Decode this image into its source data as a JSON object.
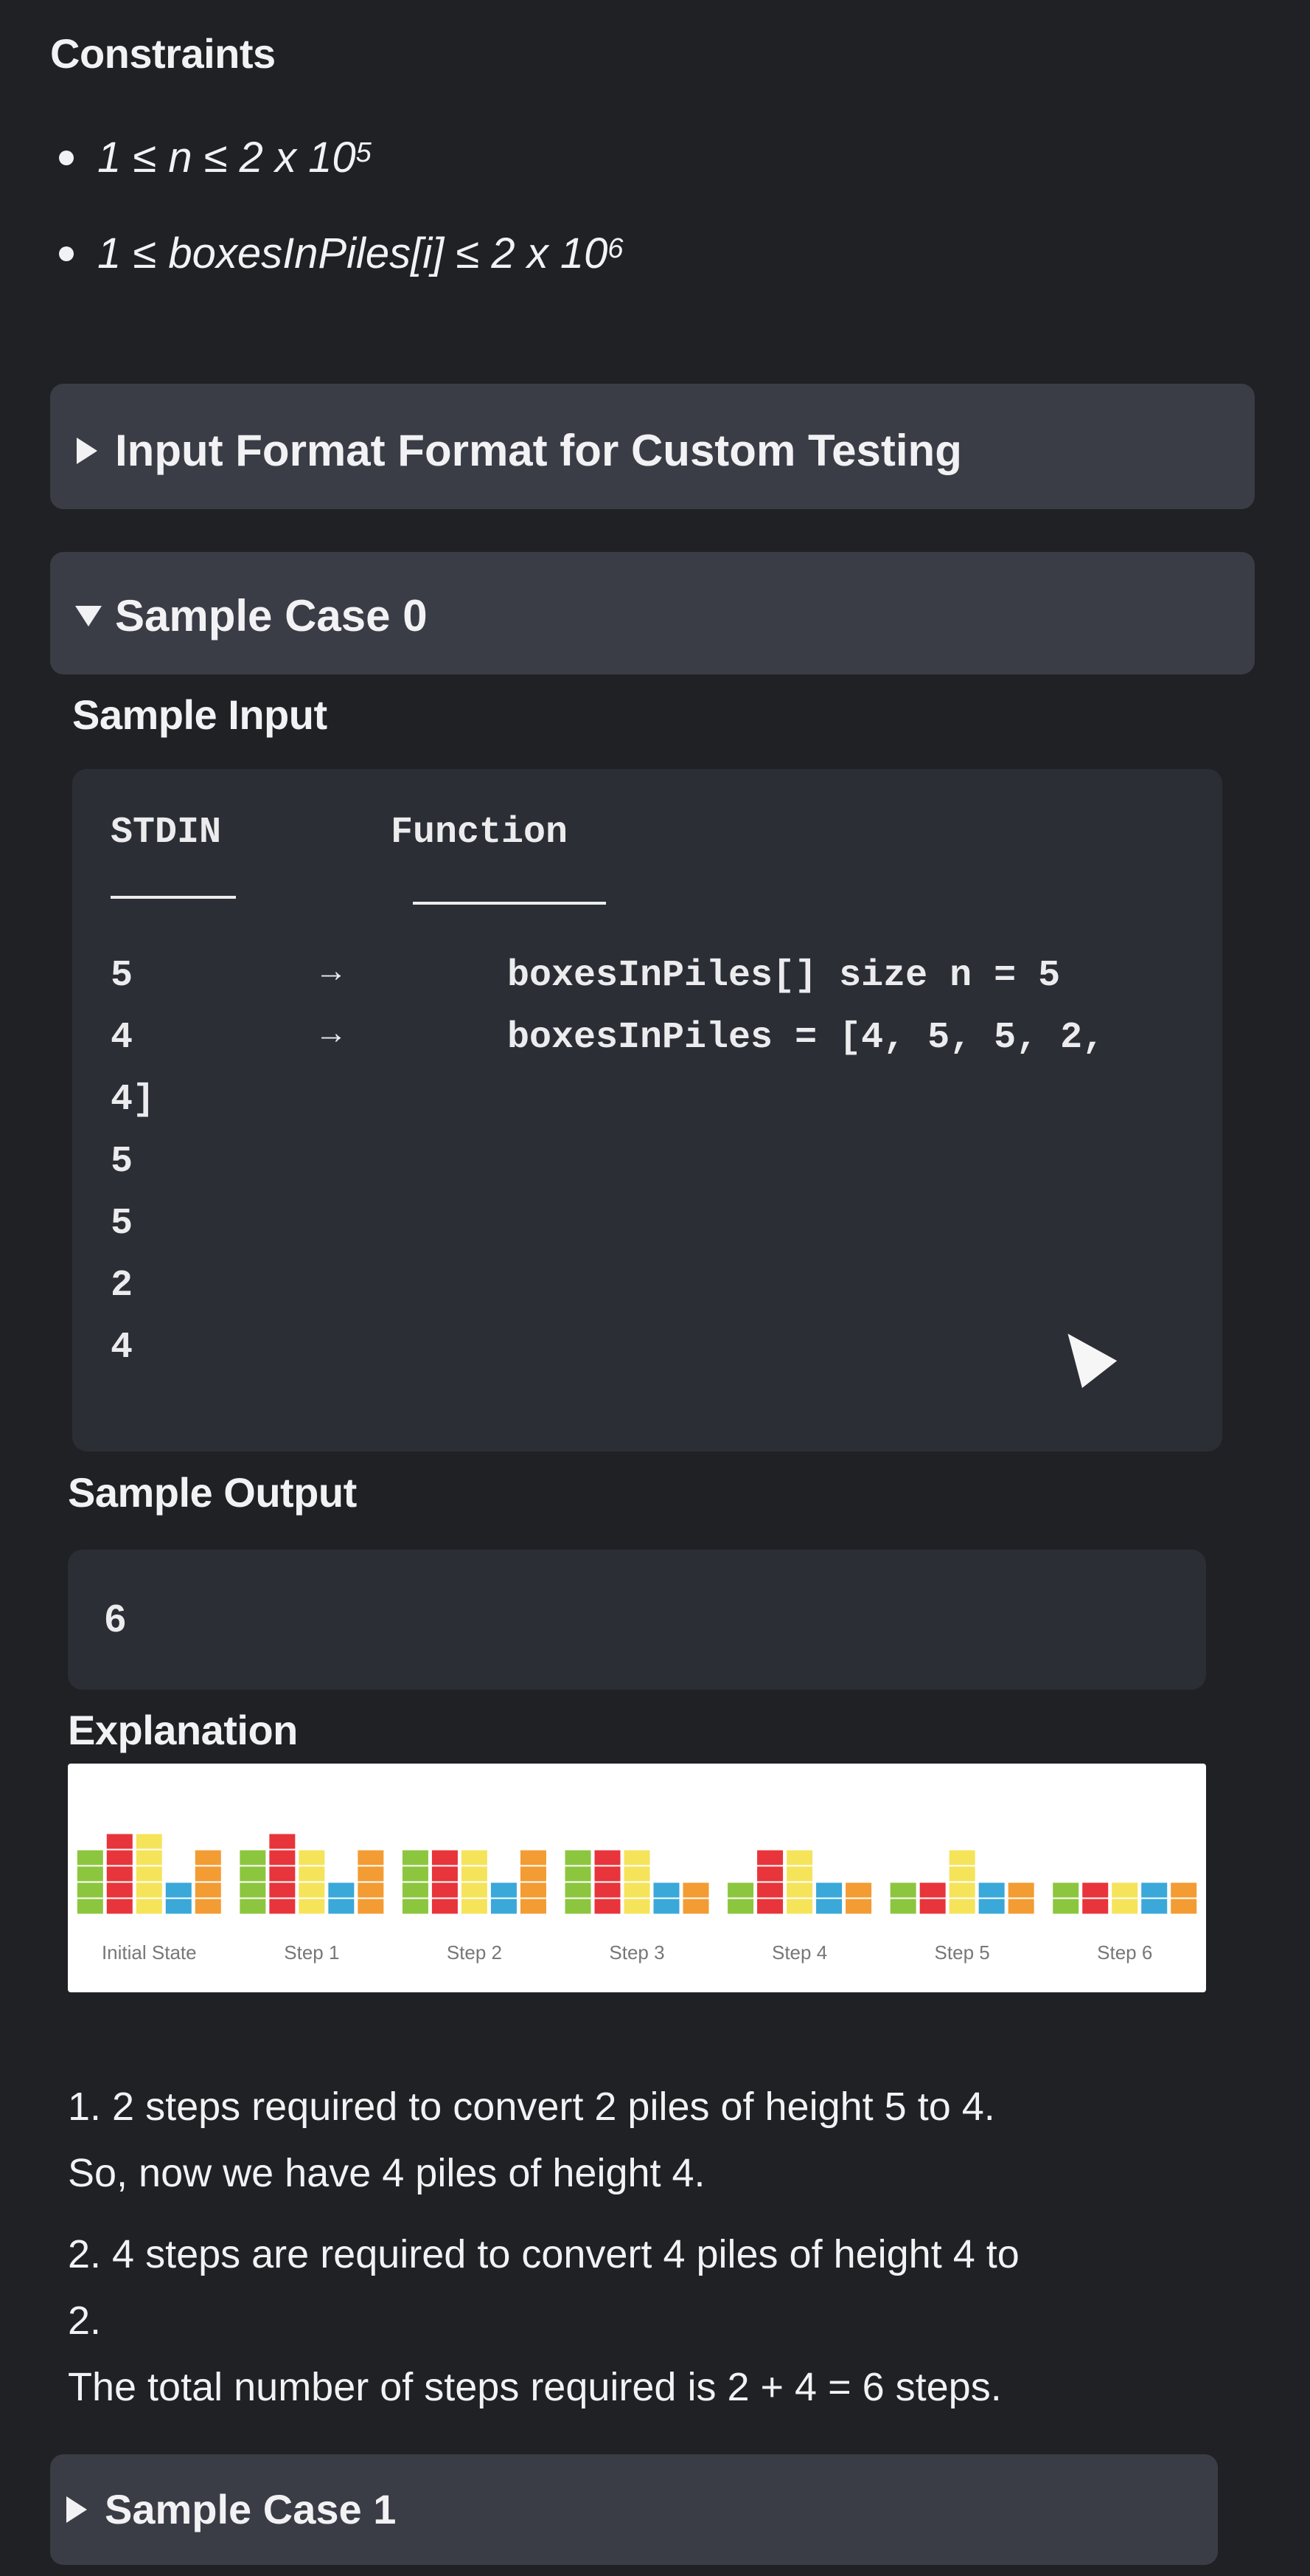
{
  "constraints": {
    "title": "Constraints",
    "items": [
      {
        "lhs": "1 ≤ n ≤ 2 x 10",
        "exp": "5"
      },
      {
        "lhs": "1 ≤ boxesInPiles[i] ≤ 2 x 10",
        "exp": "6"
      }
    ]
  },
  "input_format_panel": {
    "label": "Input Format Format for Custom Testing",
    "expanded": false
  },
  "sample_case_0": {
    "label": "Sample Case 0",
    "expanded": true,
    "input_title": "Sample Input",
    "code": {
      "header_left": "STDIN",
      "header_right": "Function",
      "underline_left": "-----",
      "underline_right": "--------",
      "lines": [
        {
          "left": "5",
          "arrow": "→",
          "right": "boxesInPiles[] size n = 5"
        },
        {
          "left": "4",
          "arrow": "→",
          "right": "boxesInPiles = [4, 5, 5, 2,"
        },
        {
          "left": "4]",
          "arrow": "",
          "right": ""
        },
        {
          "left": "5",
          "arrow": "",
          "right": ""
        },
        {
          "left": "5",
          "arrow": "",
          "right": ""
        },
        {
          "left": "2",
          "arrow": "",
          "right": ""
        },
        {
          "left": "4",
          "arrow": "",
          "right": ""
        }
      ]
    },
    "output_title": "Sample Output",
    "output_value": "6",
    "explanation_title": "Explanation",
    "figure": {
      "captions": [
        "Initial State",
        "Step 1",
        "Step 2",
        "Step 3",
        "Step 4",
        "Step 5",
        "Step 6"
      ],
      "pile_colors": [
        "#8cc63f",
        "#e8343b",
        "#f5e35a",
        "#3aa8d8",
        "#f39c33"
      ],
      "states": [
        [
          4,
          5,
          5,
          2,
          4
        ],
        [
          4,
          5,
          4,
          2,
          4
        ],
        [
          4,
          4,
          4,
          2,
          4
        ],
        [
          4,
          4,
          4,
          2,
          2
        ],
        [
          2,
          4,
          4,
          2,
          2
        ],
        [
          2,
          2,
          4,
          2,
          2
        ],
        [
          2,
          2,
          2,
          2,
          2
        ]
      ]
    },
    "explanation_lines": [
      "1. 2 steps required to convert 2 piles of height 5 to 4.",
      "So, now we have 4 piles of height 4.",
      "2. 4 steps are required to convert 4 piles of height 4 to",
      "2.",
      "The total number of steps required is 2 + 4 = 6 steps."
    ]
  },
  "sample_case_1": {
    "label": "Sample Case 1",
    "expanded": false
  }
}
